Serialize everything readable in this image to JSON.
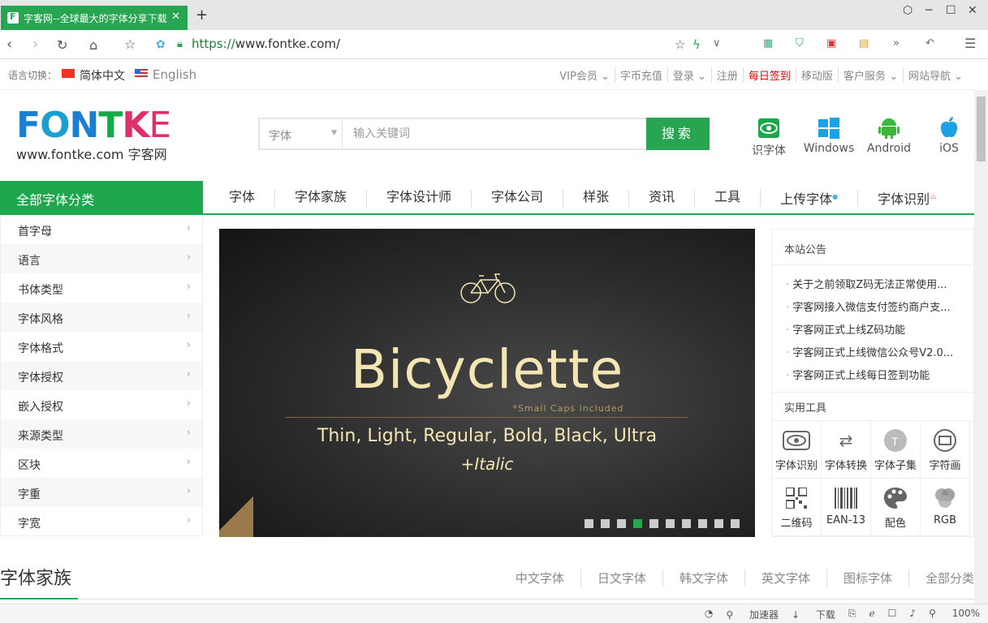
{
  "browser": {
    "tab_title": "字客网--全球最大的字体分享下载",
    "url_scheme": "https://",
    "url_rest": "www.fontke.com/",
    "zoom": "100%",
    "status": {
      "accelerator": "加速器",
      "download": "下载"
    }
  },
  "langbar": {
    "label": "语言切换：",
    "cn": "简体中文",
    "en": "English",
    "links": [
      "VIP会员 ⌄",
      "字币充值",
      "登录 ⌄",
      "注册",
      "每日签到",
      "移动版",
      "客户服务 ⌄",
      "网站导航 ⌄"
    ]
  },
  "logo": {
    "letters": [
      "F",
      "O",
      "N",
      "T",
      "K",
      "E"
    ],
    "sub": "www.fontke.com 字客网"
  },
  "search": {
    "scope": "字体",
    "placeholder": "输入关键词",
    "button": "搜索"
  },
  "platforms": [
    "识字体",
    "Windows",
    "Android",
    "iOS"
  ],
  "nav": {
    "all": "全部字体分类",
    "items": [
      "字体",
      "字体家族",
      "字体设计师",
      "字体公司",
      "样张",
      "资讯",
      "工具",
      "上传字体",
      "字体识别"
    ]
  },
  "sidebar": [
    "首字母",
    "语言",
    "书体类型",
    "字体风格",
    "字体格式",
    "字体授权",
    "嵌入授权",
    "来源类型",
    "区块",
    "字重",
    "字宽"
  ],
  "banner": {
    "title": "Bicyclette",
    "smallcaps": "*Small Caps included",
    "weights": "Thin, Light, Regular, Bold, Black, Ultra",
    "italic": "+Italic",
    "slides": 10,
    "active_slide": 4
  },
  "notices": {
    "title": "本站公告",
    "items": [
      "关于之前领取Z码无法正常使用...",
      "字客网接入微信支付签约商户支...",
      "字客网正式上线Z码功能",
      "字客网正式上线微信公众号V2.0...",
      "字客网正式上线每日签到功能"
    ]
  },
  "tools": {
    "title": "实用工具",
    "items": [
      {
        "label": "字体识别",
        "icon": "eye-icon"
      },
      {
        "label": "字体转换",
        "icon": "convert-icon"
      },
      {
        "label": "字体子集",
        "icon": "subset-icon"
      },
      {
        "label": "字符画",
        "icon": "image-icon"
      },
      {
        "label": "二维码",
        "icon": "qrcode-icon"
      },
      {
        "label": "EAN-13",
        "icon": "barcode-icon"
      },
      {
        "label": "配色",
        "icon": "palette-icon"
      },
      {
        "label": "RGB",
        "icon": "rgb-icon"
      }
    ]
  },
  "family": {
    "title": "字体家族",
    "tabs": [
      "中文字体",
      "日文字体",
      "韩文字体",
      "英文字体",
      "图标字体",
      "全部分类"
    ]
  },
  "colors": {
    "brand": "#27a550",
    "logo_blue": "#1a7fd0",
    "logo_pink": "#e0306a",
    "banner_text": "#f3e6b4"
  }
}
